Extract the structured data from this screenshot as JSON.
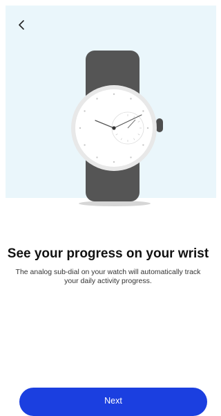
{
  "onboarding": {
    "title": "See your progress on your wrist",
    "description": "The analog sub-dial on your watch will automatically track your daily activity progress.",
    "next_label": "Next"
  },
  "icons": {
    "back": "chevron-left-icon",
    "illustration": "watch-illustration"
  },
  "colors": {
    "hero_background": "#eaf6fb",
    "primary_button": "#1b3fe0",
    "strap": "#555555",
    "watch_case": "#e8e8e8"
  }
}
